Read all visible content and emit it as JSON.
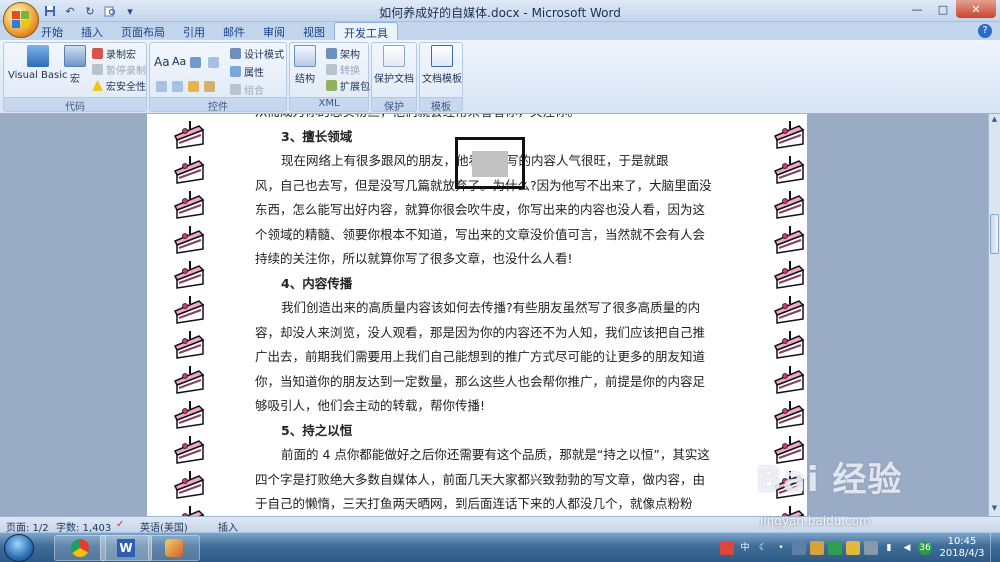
{
  "window": {
    "title": "如何养成好的自媒体.docx - Microsoft Word",
    "controls": {
      "minimize": "—",
      "maximize": "□",
      "close": "✕"
    }
  },
  "quick_access": [
    "save-icon",
    "undo-icon",
    "redo-icon",
    "print-preview-icon"
  ],
  "ribbon": {
    "tabs": [
      "开始",
      "插入",
      "页面布局",
      "引用",
      "邮件",
      "审阅",
      "视图",
      "开发工具"
    ],
    "active_tab": "开发工具",
    "groups": {
      "code": {
        "label": "代码",
        "visual_basic": "Visual Basic",
        "macros": "宏",
        "record_macro": "录制宏",
        "pause_recording": "暂停录制",
        "macro_security": "宏安全性"
      },
      "controls": {
        "label": "控件",
        "design_mode": "设计模式",
        "properties": "属性",
        "group": "组合"
      },
      "xml": {
        "label": "XML",
        "structure": "结构",
        "schema": "架构",
        "transform": "转换",
        "expansion_packs": "扩展包"
      },
      "protect": {
        "label": "保护",
        "protect_document": "保护文档"
      },
      "templates": {
        "label": "模板",
        "document_template": "文档模板"
      }
    }
  },
  "document": {
    "lines": [
      {
        "type": "cutoff",
        "text": "从而成为你的忠实粉丝，他们就会经常来看看你，关注你。"
      },
      {
        "type": "heading",
        "text": "3、擅长领域"
      },
      {
        "type": "para-first",
        "text": "现在网络上有很多跟风的朋友，他看别人写的内容人气很旺，于是就跟"
      },
      {
        "type": "para",
        "text": "风，自己也去写，但是没写几篇就放弃了。为什么?因为他写不出来了，大脑里面没"
      },
      {
        "type": "para",
        "text": "东西，怎么能写出好内容，就算你很会吹牛皮，你写出来的内容也没人看，因为这"
      },
      {
        "type": "para",
        "text": "个领域的精髓、领要你根本不知道，写出来的文章没价值可言，当然就不会有人会"
      },
      {
        "type": "para",
        "text": "持续的关注你，所以就算你写了很多文章，也没什么人看!"
      },
      {
        "type": "heading",
        "text": "4、内容传播"
      },
      {
        "type": "para-first",
        "text": "我们创造出来的高质量内容该如何去传播?有些朋友虽然写了很多高质量的内"
      },
      {
        "type": "para",
        "text": "容，却没人来浏览，没人观看，那是因为你的内容还不为人知，我们应该把自己推"
      },
      {
        "type": "para",
        "text": "广出去，前期我们需要用上我们自己能想到的推广方式尽可能的让更多的朋友知道"
      },
      {
        "type": "para",
        "text": "你，当知道你的朋友达到一定数量，那么这些人也会帮你推广，前提是你的内容足"
      },
      {
        "type": "para",
        "text": "够吸引人，他们会主动的转载，帮你传播!"
      },
      {
        "type": "heading",
        "text": "5、持之以恒"
      },
      {
        "type": "para-first",
        "text": "前面的 4 点你都能做好之后你还需要有这个品质，那就是“持之以恒”，其实这"
      },
      {
        "type": "para",
        "text": "四个字是打败绝大多数自媒体人，前面几天大家都兴致勃勃的写文章，做内容，由"
      },
      {
        "type": "para",
        "text": "于自己的懒惰，三天打鱼两天晒网，到后面连话下来的人都没几个，就像点粉粉"
      }
    ]
  },
  "statusbar": {
    "page": "页面: 1/2",
    "words": "字数: 1,403",
    "language": "英语(美国)",
    "mode": "插入"
  },
  "taskbar": {
    "tray_ime": "中",
    "tray_badge": "36",
    "time": "10:45",
    "date": "2018/4/3"
  },
  "watermark": {
    "logo": "Bai 经验",
    "site": "jingyan.baidu.com"
  },
  "colors": {
    "ribbon_bg": "#dde8f6",
    "tab_text": "#15428b",
    "page_bg": "#ffffff",
    "workspace": "#9aabc6",
    "taskbar": "#3f6c98"
  }
}
